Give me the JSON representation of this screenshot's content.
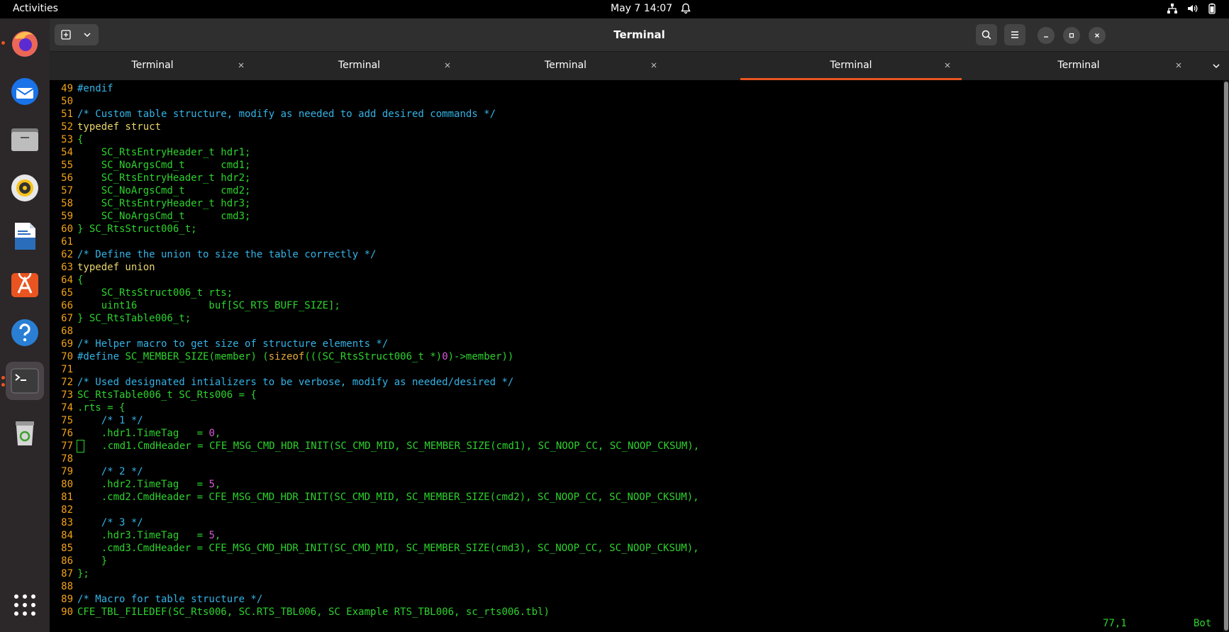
{
  "topbar": {
    "activities": "Activities",
    "clock": "May 7  14:07"
  },
  "dock": {
    "items": [
      "firefox-icon",
      "thunderbird-icon",
      "files-icon",
      "rhythmbox-icon",
      "writer-icon",
      "app-center-icon",
      "help-icon",
      "terminal-icon",
      "trash-icon",
      "app-grid-icon"
    ]
  },
  "window": {
    "title": "Terminal",
    "tabs": [
      {
        "label": "Terminal",
        "active": false
      },
      {
        "label": "Terminal",
        "active": false
      },
      {
        "label": "Terminal",
        "active": false
      },
      {
        "label": "Terminal",
        "active": true
      },
      {
        "label": "Terminal",
        "active": false
      }
    ]
  },
  "editor": {
    "lines": [
      {
        "n": "49",
        "s": [
          [
            "pp",
            "#endif"
          ]
        ]
      },
      {
        "n": "50",
        "s": []
      },
      {
        "n": "51",
        "s": [
          [
            "com",
            "/* Custom table structure, modify as needed to add desired commands */"
          ]
        ]
      },
      {
        "n": "52",
        "s": [
          [
            "kw",
            "typedef struct"
          ]
        ]
      },
      {
        "n": "53",
        "s": [
          [
            "norm",
            "{"
          ]
        ]
      },
      {
        "n": "54",
        "s": [
          [
            "norm",
            "    SC_RtsEntryHeader_t hdr1;"
          ]
        ]
      },
      {
        "n": "55",
        "s": [
          [
            "norm",
            "    SC_NoArgsCmd_t      cmd1;"
          ]
        ]
      },
      {
        "n": "56",
        "s": [
          [
            "norm",
            "    SC_RtsEntryHeader_t hdr2;"
          ]
        ]
      },
      {
        "n": "57",
        "s": [
          [
            "norm",
            "    SC_NoArgsCmd_t      cmd2;"
          ]
        ]
      },
      {
        "n": "58",
        "s": [
          [
            "norm",
            "    SC_RtsEntryHeader_t hdr3;"
          ]
        ]
      },
      {
        "n": "59",
        "s": [
          [
            "norm",
            "    SC_NoArgsCmd_t      cmd3;"
          ]
        ]
      },
      {
        "n": "60",
        "s": [
          [
            "norm",
            "} SC_RtsStruct006_t;"
          ]
        ]
      },
      {
        "n": "61",
        "s": []
      },
      {
        "n": "62",
        "s": [
          [
            "com",
            "/* Define the union to size the table correctly */"
          ]
        ]
      },
      {
        "n": "63",
        "s": [
          [
            "kw",
            "typedef union"
          ]
        ]
      },
      {
        "n": "64",
        "s": [
          [
            "norm",
            "{"
          ]
        ]
      },
      {
        "n": "65",
        "s": [
          [
            "norm",
            "    SC_RtsStruct006_t rts;"
          ]
        ]
      },
      {
        "n": "66",
        "s": [
          [
            "norm",
            "    uint16            buf[SC_RTS_BUFF_SIZE];"
          ]
        ]
      },
      {
        "n": "67",
        "s": [
          [
            "norm",
            "} SC_RtsTable006_t;"
          ]
        ]
      },
      {
        "n": "68",
        "s": []
      },
      {
        "n": "69",
        "s": [
          [
            "com",
            "/* Helper macro to get size of structure elements */"
          ]
        ]
      },
      {
        "n": "70",
        "s": [
          [
            "pp",
            "#define"
          ],
          [
            "norm",
            " SC_MEMBER_SIZE(member) ("
          ],
          [
            "fn",
            "sizeof"
          ],
          [
            "norm",
            "(((SC_RtsStruct006_t *)"
          ],
          [
            "num",
            "0"
          ],
          [
            "norm",
            ")->member))"
          ]
        ]
      },
      {
        "n": "71",
        "s": []
      },
      {
        "n": "72",
        "s": [
          [
            "com",
            "/* Used designated intializers to be verbose, modify as needed/desired */"
          ]
        ]
      },
      {
        "n": "73",
        "s": [
          [
            "norm",
            "SC_RtsTable006_t SC_Rts006 = {"
          ]
        ]
      },
      {
        "n": "74",
        "s": [
          [
            "norm",
            ".rts = {"
          ]
        ]
      },
      {
        "n": "75",
        "s": [
          [
            "norm",
            "    "
          ],
          [
            "com",
            "/* 1 */"
          ]
        ]
      },
      {
        "n": "76",
        "s": [
          [
            "norm",
            "    .hdr1.TimeTag   = "
          ],
          [
            "num",
            "0"
          ],
          [
            "norm",
            ","
          ]
        ]
      },
      {
        "n": "77",
        "cursor": true,
        "s": [
          [
            "norm",
            "   .cmd1.CmdHeader = CFE_MSG_CMD_HDR_INIT(SC_CMD_MID, SC_MEMBER_SIZE(cmd1), SC_NOOP_CC, SC_NOOP_CKSUM),"
          ]
        ]
      },
      {
        "n": "78",
        "s": []
      },
      {
        "n": "79",
        "s": [
          [
            "norm",
            "    "
          ],
          [
            "com",
            "/* 2 */"
          ]
        ]
      },
      {
        "n": "80",
        "s": [
          [
            "norm",
            "    .hdr2.TimeTag   = "
          ],
          [
            "num",
            "5"
          ],
          [
            "norm",
            ","
          ]
        ]
      },
      {
        "n": "81",
        "s": [
          [
            "norm",
            "    .cmd2.CmdHeader = CFE_MSG_CMD_HDR_INIT(SC_CMD_MID, SC_MEMBER_SIZE(cmd2), SC_NOOP_CC, SC_NOOP_CKSUM),"
          ]
        ]
      },
      {
        "n": "82",
        "s": []
      },
      {
        "n": "83",
        "s": [
          [
            "norm",
            "    "
          ],
          [
            "com",
            "/* 3 */"
          ]
        ]
      },
      {
        "n": "84",
        "s": [
          [
            "norm",
            "    .hdr3.TimeTag   = "
          ],
          [
            "num",
            "5"
          ],
          [
            "norm",
            ","
          ]
        ]
      },
      {
        "n": "85",
        "s": [
          [
            "norm",
            "    .cmd3.CmdHeader = CFE_MSG_CMD_HDR_INIT(SC_CMD_MID, SC_MEMBER_SIZE(cmd3), SC_NOOP_CC, SC_NOOP_CKSUM),"
          ]
        ]
      },
      {
        "n": "86",
        "s": [
          [
            "norm",
            "    }"
          ]
        ]
      },
      {
        "n": "87",
        "s": [
          [
            "norm",
            "};"
          ]
        ]
      },
      {
        "n": "88",
        "s": []
      },
      {
        "n": "89",
        "s": [
          [
            "com",
            "/* Macro for table structure */"
          ]
        ]
      },
      {
        "n": "90",
        "s": [
          [
            "norm",
            "CFE_TBL_FILEDEF(SC_Rts006, SC.RTS_TBL006, SC Example RTS_TBL006, sc_rts006.tbl)"
          ]
        ]
      }
    ],
    "status_position": "77,1",
    "status_scroll": "Bot"
  },
  "colors": {
    "accent": "#e95420",
    "code_default": "#2dd22d",
    "line_number": "#f2a215",
    "comment": "#33b3e6",
    "keyword": "#e8d56a",
    "number": "#d85ad8"
  }
}
